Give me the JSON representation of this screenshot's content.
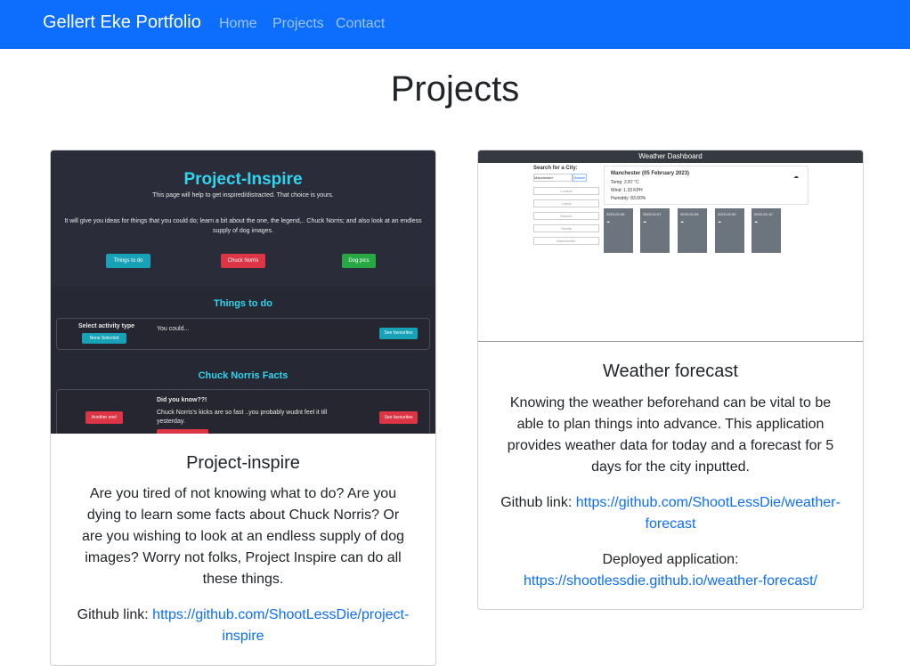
{
  "nav": {
    "brand": "Gellert Eke Portfolio",
    "links": [
      "Home",
      "Projects",
      "Contact"
    ]
  },
  "page": {
    "title": "Projects"
  },
  "colors": {
    "navbar": "#0d6efd",
    "link": "#0d6efd",
    "accent_cyan": "#2fd5ee"
  },
  "projects": [
    {
      "title": "Project-inspire",
      "description": "Are you tired of not knowing what to do? Are you dying to learn some facts about Chuck Norris? Or are you wishing to look at an endless supply of dog images? Worry not folks, Project Inspire can do all these things.",
      "github_label": "Github link:",
      "github_url": "https://github.com/ShootLessDie/project-inspire",
      "screenshot": {
        "heading": "Project-Inspire",
        "subtitle": "This page will help to get inspired/distracted. That choice is yours.",
        "intro": "It will give you ideas for things that you could do; learn a bit about the one, the legend,.. Chuck Norris; and also look at an endless supply of dog images.",
        "buttons": [
          "Things to do",
          "Chuck Norris",
          "Dog pics"
        ],
        "section1": "Things to do",
        "select_label": "Select activity type",
        "select_value": "None Selected",
        "you_could": "You could...",
        "see_fav": "See favourites",
        "section2": "Chuck Norris Facts",
        "did_you_know": "Did you know??!",
        "fact": "Chuck Norris's kicks are so fast ..you probably wudnt feel it till yesterday.",
        "another": "Another one!"
      }
    },
    {
      "title": "Weather forecast",
      "description": "Knowing the weather beforehand can be vital to be able to plan things into advance. This application provides weather data for today and a forecast for 5 days for the city inputted.",
      "github_label": "Github link:",
      "github_url": "https://github.com/ShootLessDie/weather-forecast",
      "deployed_label": "Deployed application:",
      "deployed_url": "https://shootlessdie.github.io/weather-forecast/",
      "screenshot": {
        "header": "Weather Dashboard",
        "search_label": "Search for a City:",
        "search_value": "Manchester",
        "search_button": "Search",
        "history": [
          "London",
          "Leeds",
          "Munich",
          "Sevilla",
          "Manchester"
        ],
        "today_title": "Manchester (05 February 2023)",
        "today_temp": "Temp: 2.87 °C",
        "today_wind": "Wind: 1.33 KPH",
        "today_humidity": "Humidity: 83.00%",
        "days": [
          "2023-02-06",
          "2023-02-07",
          "2023-02-08",
          "2023-02-09",
          "2023-02-10"
        ]
      }
    }
  ]
}
